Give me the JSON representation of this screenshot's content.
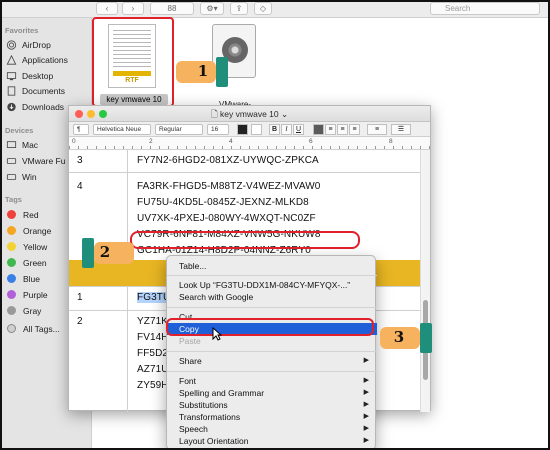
{
  "toolbar": {
    "view_btn": "88",
    "action_btn": "⚙▾",
    "share_btn": "⇪",
    "tag_btn": "◇",
    "search_placeholder": "Search"
  },
  "sidebar": {
    "favorites_header": "Favorites",
    "favorites": [
      "AirDrop",
      "Applications",
      "Desktop",
      "Documents",
      "Downloads"
    ],
    "devices_header": "Devices",
    "devices": [
      "Mac",
      "VMware Fu",
      "Win"
    ],
    "tags_header": "Tags",
    "tags": [
      {
        "label": "Red",
        "color": "#f0403c"
      },
      {
        "label": "Orange",
        "color": "#f5a623"
      },
      {
        "label": "Yellow",
        "color": "#f3d233"
      },
      {
        "label": "Green",
        "color": "#3fb94e"
      },
      {
        "label": "Blue",
        "color": "#3a7fe8"
      },
      {
        "label": "Purple",
        "color": "#b060d8"
      },
      {
        "label": "Gray",
        "color": "#9a9a9a"
      }
    ],
    "all_tags": "All Tags..."
  },
  "files": {
    "rtf_label": "key vmwave 10",
    "rtf_badge": "RTF",
    "dmg_label": "VMware-"
  },
  "textedit": {
    "title": "key vmwave 10",
    "title_suffix": "⌄",
    "format": {
      "paragraph_style": "¶",
      "font": "Helvetica Neue",
      "weight": "Regular",
      "size": "16",
      "bold": "B",
      "italic": "I",
      "underline": "U"
    },
    "ruler_numbers": [
      "0",
      "2",
      "4",
      "6",
      "8"
    ],
    "rows": [
      {
        "num": "3",
        "keys": [
          "FY7N2-6HGD2-081XZ-UYWQC-ZPKCA"
        ]
      },
      {
        "num": "4",
        "keys": [
          "FA3RK-FHGD5-M88TZ-V4WEZ-MVAW0",
          "FU75U-4KD5L-0845Z-JEXNZ-MLKD8",
          "UV7XK-4PXEJ-080WY-4WXQT-NC0ZF",
          "VC79R-6NF81-M84XZ-VNW5G-NKUW8",
          "GC1HA-01Z14-H8D2P-04NNZ-Z6RY0"
        ]
      },
      {
        "num": "1",
        "keys": [
          "FG3TU"
        ]
      },
      {
        "num": "2",
        "keys": [
          "YZ71K",
          "FV14H",
          "FF5D2",
          "AZ71U",
          "ZY59H"
        ]
      }
    ]
  },
  "context_menu": {
    "items": [
      {
        "label": "Table...",
        "state": "normal"
      },
      {
        "label": "Look Up “FG3TU-DDX1M-084CY-MFYQX-...”",
        "state": "normal"
      },
      {
        "label": "Search with Google",
        "state": "normal"
      },
      {
        "label": "Cut",
        "state": "normal"
      },
      {
        "label": "Copy",
        "state": "active"
      },
      {
        "label": "Paste",
        "state": "disabled"
      },
      {
        "label": "Share",
        "state": "submenu"
      },
      {
        "label": "Font",
        "state": "submenu"
      },
      {
        "label": "Spelling and Grammar",
        "state": "submenu"
      },
      {
        "label": "Substitutions",
        "state": "submenu"
      },
      {
        "label": "Transformations",
        "state": "submenu"
      },
      {
        "label": "Speech",
        "state": "submenu"
      },
      {
        "label": "Layout Orientation",
        "state": "submenu"
      }
    ],
    "submenu_arrow": "▶"
  },
  "steps": [
    "1",
    "2",
    "3"
  ],
  "colors": {
    "highlight_band": "#e8b623",
    "annotation_red": "#e0212b",
    "menu_active": "#1f5fd7",
    "hand_cuff": "#1f8e7a",
    "hand_skin": "#f7b25f"
  }
}
